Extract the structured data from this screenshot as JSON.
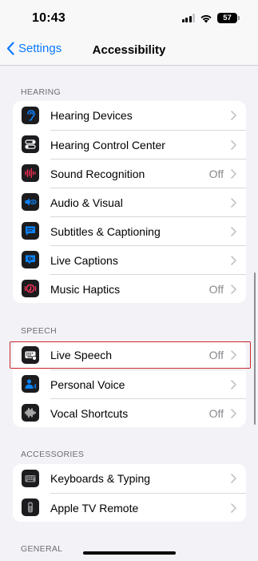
{
  "status_bar": {
    "time": "10:43",
    "battery": "57"
  },
  "nav": {
    "back_label": "Settings",
    "title": "Accessibility"
  },
  "sections": [
    {
      "header": "HEARING",
      "rows": [
        {
          "label": "Hearing Devices",
          "value": "",
          "icon": "ear-icon"
        },
        {
          "label": "Hearing Control Center",
          "value": "",
          "icon": "toggles-icon"
        },
        {
          "label": "Sound Recognition",
          "value": "Off",
          "icon": "waveform-icon"
        },
        {
          "label": "Audio & Visual",
          "value": "",
          "icon": "speaker-eye-icon"
        },
        {
          "label": "Subtitles & Captioning",
          "value": "",
          "icon": "captions-icon"
        },
        {
          "label": "Live Captions",
          "value": "",
          "icon": "live-captions-icon"
        },
        {
          "label": "Music Haptics",
          "value": "Off",
          "icon": "music-haptics-icon"
        }
      ]
    },
    {
      "header": "SPEECH",
      "rows": [
        {
          "label": "Live Speech",
          "value": "Off",
          "icon": "keyboard-speech-icon"
        },
        {
          "label": "Personal Voice",
          "value": "",
          "icon": "person-voice-icon"
        },
        {
          "label": "Vocal Shortcuts",
          "value": "Off",
          "icon": "vocal-waveform-icon"
        }
      ]
    },
    {
      "header": "ACCESSORIES",
      "rows": [
        {
          "label": "Keyboards & Typing",
          "value": "",
          "icon": "keyboard-icon"
        },
        {
          "label": "Apple TV Remote",
          "value": "",
          "icon": "remote-icon"
        }
      ]
    },
    {
      "header": "GENERAL",
      "rows": []
    }
  ],
  "colors": {
    "accent": "#0a7aff",
    "highlight": "#c8262b",
    "icon_bg": "#1c1c1e"
  }
}
